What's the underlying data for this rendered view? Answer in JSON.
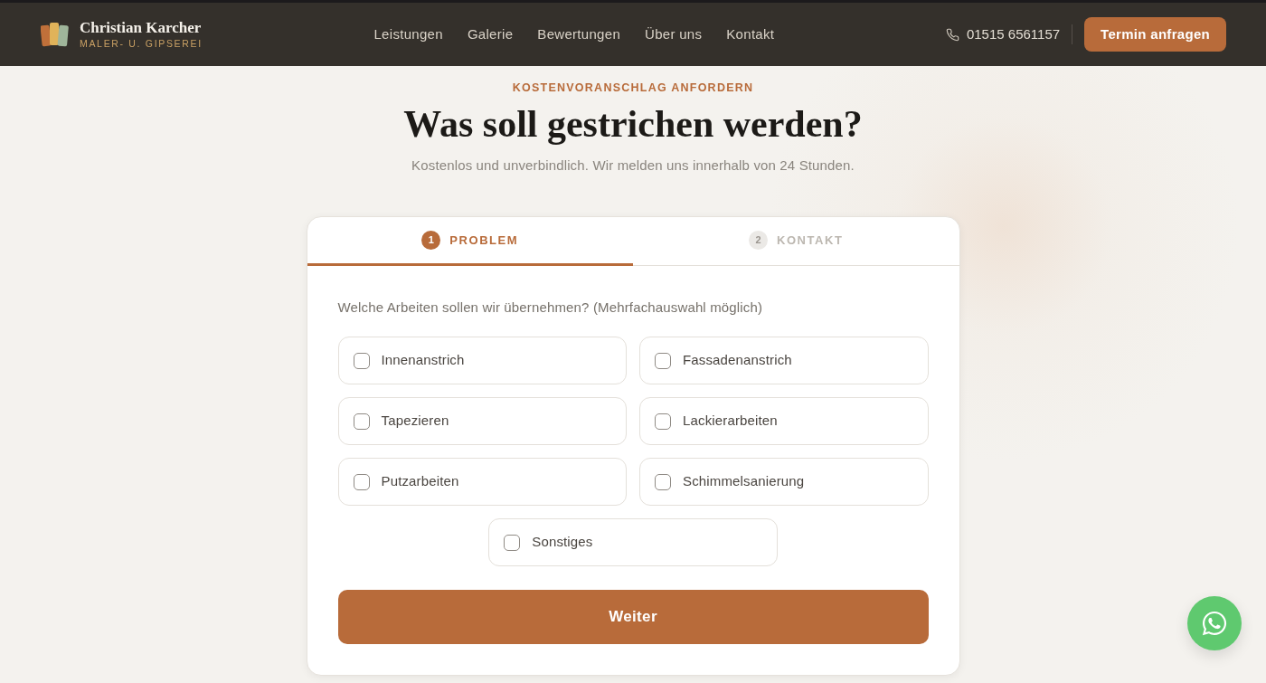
{
  "header": {
    "brand": {
      "name": "Christian Karcher",
      "tagline": "MALER- U. GIPSEREI"
    },
    "nav": [
      "Leistungen",
      "Galerie",
      "Bewertungen",
      "Über uns",
      "Kontakt"
    ],
    "phone": "01515 6561157",
    "cta": "Termin anfragen"
  },
  "intro": {
    "eyebrow": "KOSTENVORANSCHLAG ANFORDERN",
    "title": "Was soll gestrichen werden?",
    "subtitle": "Kostenlos und unverbindlich. Wir melden uns innerhalb von 24 Stunden."
  },
  "form": {
    "steps": [
      {
        "number": "1",
        "label": "PROBLEM",
        "selected": true
      },
      {
        "number": "2",
        "label": "KONTAKT",
        "selected": false
      }
    ],
    "question": "Welche Arbeiten sollen wir übernehmen? (Mehrfachauswahl möglich)",
    "options": [
      {
        "label": "Innenanstrich",
        "checked": false
      },
      {
        "label": "Fassadenanstrich",
        "checked": false
      },
      {
        "label": "Tapezieren",
        "checked": false
      },
      {
        "label": "Lackierarbeiten",
        "checked": false
      },
      {
        "label": "Putzarbeiten",
        "checked": false
      },
      {
        "label": "Schimmelsanierung",
        "checked": false
      },
      {
        "label": "Sonstiges",
        "checked": false
      }
    ],
    "submit": "Weiter"
  }
}
